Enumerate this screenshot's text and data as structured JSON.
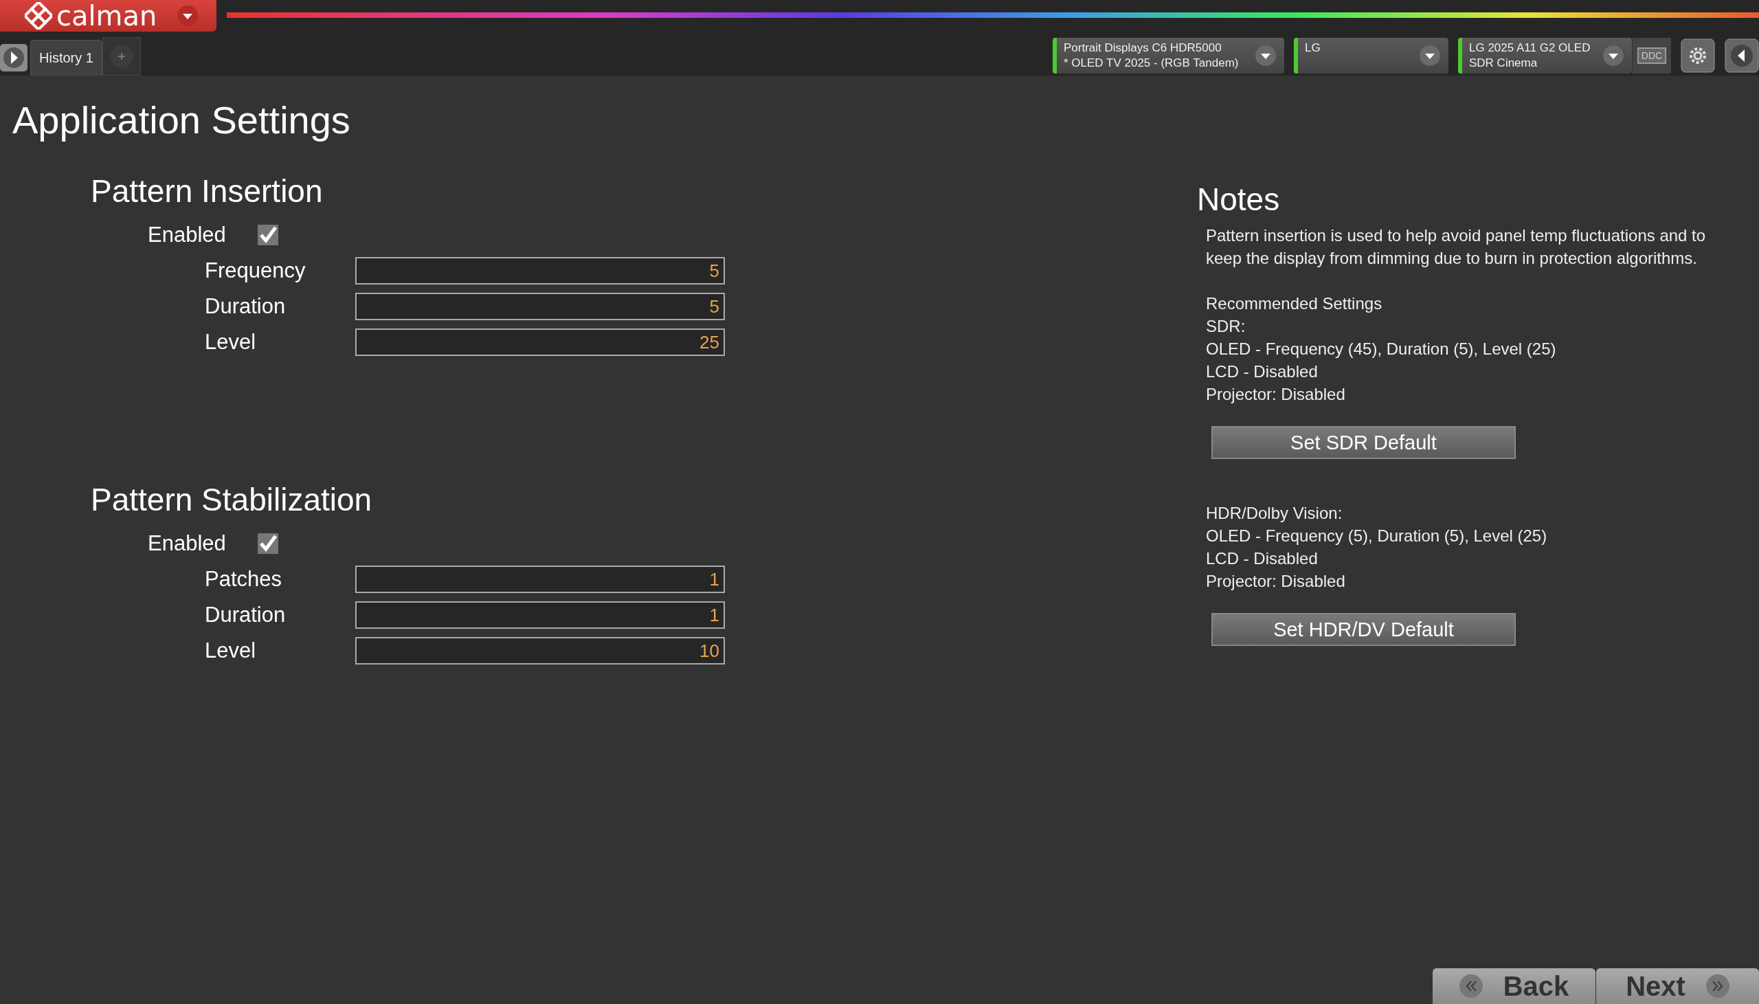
{
  "logo": {
    "text": "calman"
  },
  "tabs": [
    {
      "label": "History 1",
      "selected": true
    }
  ],
  "devices": [
    {
      "line1": "Portrait Displays C6 HDR5000",
      "line2": "* OLED TV 2025 - (RGB Tandem)"
    },
    {
      "line1": "LG"
    },
    {
      "line1": "LG 2025 A11 G2 OLED",
      "line2": "SDR Cinema"
    }
  ],
  "ddc_label": "DDC",
  "page_title": "Application Settings",
  "sections": [
    {
      "title": "Pattern Insertion",
      "enabled": {
        "label": "Enabled",
        "checked": true
      },
      "fields": [
        {
          "label": "Frequency",
          "value": "5"
        },
        {
          "label": "Duration",
          "value": "5"
        },
        {
          "label": "Level",
          "value": "25"
        }
      ]
    },
    {
      "title": "Pattern Stabilization",
      "enabled": {
        "label": "Enabled",
        "checked": true
      },
      "fields": [
        {
          "label": "Patches",
          "value": "1"
        },
        {
          "label": "Duration",
          "value": "1"
        },
        {
          "label": "Level",
          "value": "10"
        }
      ]
    }
  ],
  "notes": {
    "title": "Notes",
    "intro": "Pattern insertion is used to help avoid panel temp fluctuations and to keep the display from dimming due to burn in protection algorithms.",
    "blocks": [
      {
        "lines": [
          "Recommended Settings",
          "SDR:",
          "OLED - Frequency (45), Duration (5), Level (25)",
          "LCD - Disabled",
          "Projector: Disabled"
        ],
        "button": "Set SDR Default"
      },
      {
        "lines": [
          "HDR/Dolby Vision:",
          "OLED - Frequency (5), Duration (5), Level (25)",
          "LCD - Disabled",
          "Projector: Disabled"
        ],
        "button": "Set HDR/DV Default"
      }
    ]
  },
  "nav": {
    "back": "Back",
    "next": "Next"
  }
}
